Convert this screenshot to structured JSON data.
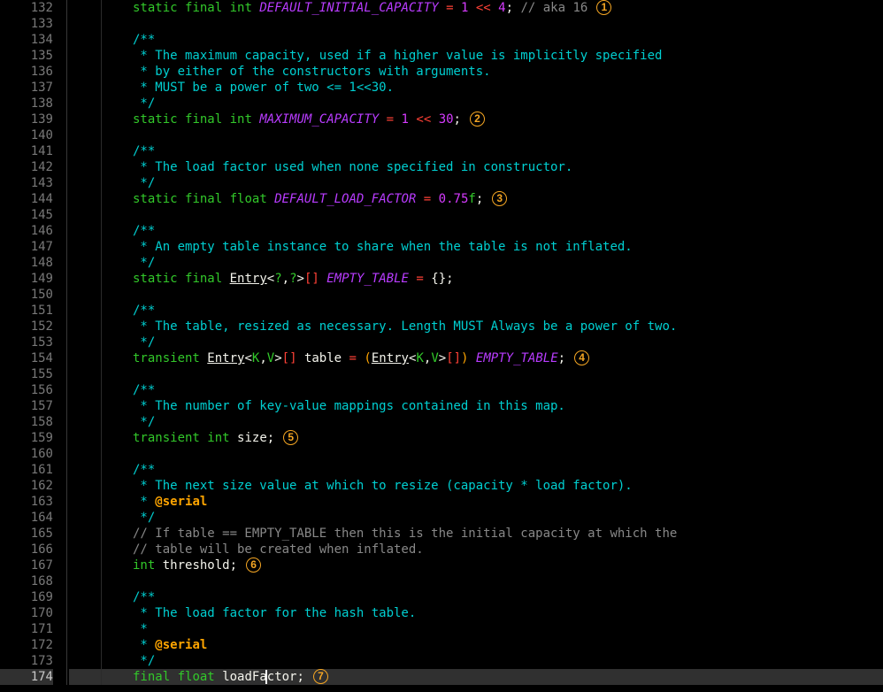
{
  "gutter": {
    "start": 132,
    "end": 174
  },
  "lines": [
    {
      "n": 132,
      "frag": [
        [
          "kw",
          "static"
        ],
        [
          "sp",
          " "
        ],
        [
          "kw",
          "final"
        ],
        [
          "sp",
          " "
        ],
        [
          "kw",
          "int"
        ],
        [
          "sp",
          " "
        ],
        [
          "id-italic",
          "DEFAULT_INITIAL_CAPACITY"
        ],
        [
          "sp",
          " "
        ],
        [
          "eq",
          "="
        ],
        [
          "sp",
          " "
        ],
        [
          "num",
          "1"
        ],
        [
          "sp",
          " "
        ],
        [
          "op",
          "<<"
        ],
        [
          "sp",
          " "
        ],
        [
          "num",
          "4"
        ],
        [
          "punct",
          ";"
        ],
        [
          "sp",
          " "
        ],
        [
          "comment",
          "// aka 16"
        ]
      ],
      "badge": "1"
    },
    {
      "n": 133,
      "frag": []
    },
    {
      "n": 134,
      "frag": [
        [
          "jdoc",
          "/**"
        ]
      ]
    },
    {
      "n": 135,
      "frag": [
        [
          "jdoc",
          " * The maximum capacity, used if a higher value is implicitly specified"
        ]
      ]
    },
    {
      "n": 136,
      "frag": [
        [
          "jdoc",
          " * by either of the constructors with arguments."
        ]
      ]
    },
    {
      "n": 137,
      "frag": [
        [
          "jdoc",
          " * MUST be a power of two <= 1<<30."
        ]
      ]
    },
    {
      "n": 138,
      "frag": [
        [
          "jdoc",
          " */"
        ]
      ]
    },
    {
      "n": 139,
      "frag": [
        [
          "kw",
          "static"
        ],
        [
          "sp",
          " "
        ],
        [
          "kw",
          "final"
        ],
        [
          "sp",
          " "
        ],
        [
          "kw",
          "int"
        ],
        [
          "sp",
          " "
        ],
        [
          "id-italic",
          "MAXIMUM_CAPACITY"
        ],
        [
          "sp",
          " "
        ],
        [
          "eq",
          "="
        ],
        [
          "sp",
          " "
        ],
        [
          "num",
          "1"
        ],
        [
          "sp",
          " "
        ],
        [
          "op",
          "<<"
        ],
        [
          "sp",
          " "
        ],
        [
          "num",
          "30"
        ],
        [
          "punct",
          ";"
        ]
      ],
      "badge": "2"
    },
    {
      "n": 140,
      "frag": []
    },
    {
      "n": 141,
      "frag": [
        [
          "jdoc",
          "/**"
        ]
      ]
    },
    {
      "n": 142,
      "frag": [
        [
          "jdoc",
          " * The load factor used when none specified in constructor."
        ]
      ]
    },
    {
      "n": 143,
      "frag": [
        [
          "jdoc",
          " */"
        ]
      ]
    },
    {
      "n": 144,
      "frag": [
        [
          "kw",
          "static"
        ],
        [
          "sp",
          " "
        ],
        [
          "kw",
          "final"
        ],
        [
          "sp",
          " "
        ],
        [
          "kw",
          "float"
        ],
        [
          "sp",
          " "
        ],
        [
          "id-italic",
          "DEFAULT_LOAD_FACTOR"
        ],
        [
          "sp",
          " "
        ],
        [
          "eq",
          "="
        ],
        [
          "sp",
          " "
        ],
        [
          "num",
          "0.75"
        ],
        [
          "suffix",
          "f"
        ],
        [
          "punct",
          ";"
        ]
      ],
      "badge": "3"
    },
    {
      "n": 145,
      "frag": []
    },
    {
      "n": 146,
      "frag": [
        [
          "jdoc",
          "/**"
        ]
      ]
    },
    {
      "n": 147,
      "frag": [
        [
          "jdoc",
          " * An empty table instance to share when the table is not inflated."
        ]
      ]
    },
    {
      "n": 148,
      "frag": [
        [
          "jdoc",
          " */"
        ]
      ]
    },
    {
      "n": 149,
      "frag": [
        [
          "kw",
          "static"
        ],
        [
          "sp",
          " "
        ],
        [
          "kw",
          "final"
        ],
        [
          "sp",
          " "
        ],
        [
          "type",
          "Entry"
        ],
        [
          "ang",
          "<"
        ],
        [
          "gparam",
          "?"
        ],
        [
          "ang",
          ","
        ],
        [
          "gparam",
          "?"
        ],
        [
          "ang",
          ">"
        ],
        [
          "brackets",
          "[]"
        ],
        [
          "sp",
          " "
        ],
        [
          "id-italic",
          "EMPTY_TABLE"
        ],
        [
          "sp",
          " "
        ],
        [
          "eq",
          "="
        ],
        [
          "sp",
          " "
        ],
        [
          "punct",
          "{};"
        ]
      ]
    },
    {
      "n": 150,
      "frag": []
    },
    {
      "n": 151,
      "frag": [
        [
          "jdoc",
          "/**"
        ]
      ]
    },
    {
      "n": 152,
      "frag": [
        [
          "jdoc",
          " * The table, resized as necessary. Length MUST Always be a power of two."
        ]
      ]
    },
    {
      "n": 153,
      "frag": [
        [
          "jdoc",
          " */"
        ]
      ]
    },
    {
      "n": 154,
      "frag": [
        [
          "kw",
          "transient"
        ],
        [
          "sp",
          " "
        ],
        [
          "type",
          "Entry"
        ],
        [
          "ang",
          "<"
        ],
        [
          "gparam",
          "K"
        ],
        [
          "ang",
          ","
        ],
        [
          "gparam",
          "V"
        ],
        [
          "ang",
          ">"
        ],
        [
          "brackets",
          "[]"
        ],
        [
          "sp",
          " "
        ],
        [
          "id",
          "table"
        ],
        [
          "sp",
          " "
        ],
        [
          "eq",
          "="
        ],
        [
          "sp",
          " "
        ],
        [
          "paren",
          "("
        ],
        [
          "type",
          "Entry"
        ],
        [
          "ang",
          "<"
        ],
        [
          "gparam",
          "K"
        ],
        [
          "ang",
          ","
        ],
        [
          "gparam",
          "V"
        ],
        [
          "ang",
          ">"
        ],
        [
          "brackets",
          "[]"
        ],
        [
          "paren",
          ")"
        ],
        [
          "sp",
          " "
        ],
        [
          "id-italic",
          "EMPTY_TABLE"
        ],
        [
          "punct",
          ";"
        ]
      ],
      "badge": "4"
    },
    {
      "n": 155,
      "frag": []
    },
    {
      "n": 156,
      "frag": [
        [
          "jdoc",
          "/**"
        ]
      ]
    },
    {
      "n": 157,
      "frag": [
        [
          "jdoc",
          " * The number of key-value mappings contained in this map."
        ]
      ]
    },
    {
      "n": 158,
      "frag": [
        [
          "jdoc",
          " */"
        ]
      ]
    },
    {
      "n": 159,
      "frag": [
        [
          "kw",
          "transient"
        ],
        [
          "sp",
          " "
        ],
        [
          "kw",
          "int"
        ],
        [
          "sp",
          " "
        ],
        [
          "id",
          "size"
        ],
        [
          "punct",
          ";"
        ]
      ],
      "badge": "5"
    },
    {
      "n": 160,
      "frag": []
    },
    {
      "n": 161,
      "frag": [
        [
          "jdoc",
          "/**"
        ]
      ]
    },
    {
      "n": 162,
      "frag": [
        [
          "jdoc",
          " * The next size value at which to resize (capacity * load factor)."
        ]
      ]
    },
    {
      "n": 163,
      "frag": [
        [
          "jdoc",
          " * "
        ],
        [
          "tag",
          "@serial"
        ]
      ]
    },
    {
      "n": 164,
      "frag": [
        [
          "jdoc",
          " */"
        ]
      ]
    },
    {
      "n": 165,
      "frag": [
        [
          "comment",
          "// If table == EMPTY_TABLE then this is the initial capacity at which the"
        ]
      ]
    },
    {
      "n": 166,
      "frag": [
        [
          "comment",
          "// table will be created when inflated."
        ]
      ]
    },
    {
      "n": 167,
      "frag": [
        [
          "kw",
          "int"
        ],
        [
          "sp",
          " "
        ],
        [
          "id",
          "threshold"
        ],
        [
          "punct",
          ";"
        ]
      ],
      "badge": "6"
    },
    {
      "n": 168,
      "frag": []
    },
    {
      "n": 169,
      "frag": [
        [
          "jdoc",
          "/**"
        ]
      ]
    },
    {
      "n": 170,
      "frag": [
        [
          "jdoc",
          " * The load factor for the hash table."
        ]
      ]
    },
    {
      "n": 171,
      "frag": [
        [
          "jdoc",
          " *"
        ]
      ]
    },
    {
      "n": 172,
      "frag": [
        [
          "jdoc",
          " * "
        ],
        [
          "tag",
          "@serial"
        ]
      ]
    },
    {
      "n": 173,
      "frag": [
        [
          "jdoc",
          " */"
        ]
      ]
    },
    {
      "n": 174,
      "hl": true,
      "caret": true,
      "frag": [
        [
          "kw",
          "final"
        ],
        [
          "sp",
          " "
        ],
        [
          "kw",
          "float"
        ],
        [
          "sp",
          " "
        ],
        [
          "id",
          "loadFactor"
        ],
        [
          "punct",
          ";"
        ]
      ],
      "badge": "7"
    }
  ]
}
